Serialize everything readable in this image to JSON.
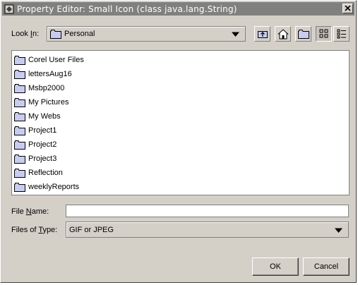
{
  "window": {
    "title": "Property Editor: Small Icon (class java.lang.String)"
  },
  "lookin": {
    "label_prefix": "Look ",
    "label_mnemonic": "I",
    "label_suffix": "n:",
    "value": "Personal"
  },
  "toolbar": {
    "up_icon": "up-one-level-icon",
    "home_icon": "home-icon",
    "new_folder_icon": "new-folder-icon",
    "list_icon": "list-view-icon",
    "details_icon": "details-view-icon"
  },
  "files": [
    "Corel User Files",
    "lettersAug16",
    "Msbp2000",
    "My Pictures",
    "My Webs",
    "Project1",
    "Project2",
    "Project3",
    "Reflection",
    "weeklyReports"
  ],
  "filename": {
    "label_prefix": "File ",
    "label_mnemonic": "N",
    "label_suffix": "ame:",
    "value": ""
  },
  "filetype": {
    "label": "Files of ",
    "label_mnemonic": "T",
    "label_suffix": "ype:",
    "value": "GIF or JPEG"
  },
  "buttons": {
    "ok": "OK",
    "cancel": "Cancel"
  },
  "colors": {
    "titlebar": "#808080",
    "face": "#d4d0c8",
    "folder": "#c8ccf0"
  }
}
